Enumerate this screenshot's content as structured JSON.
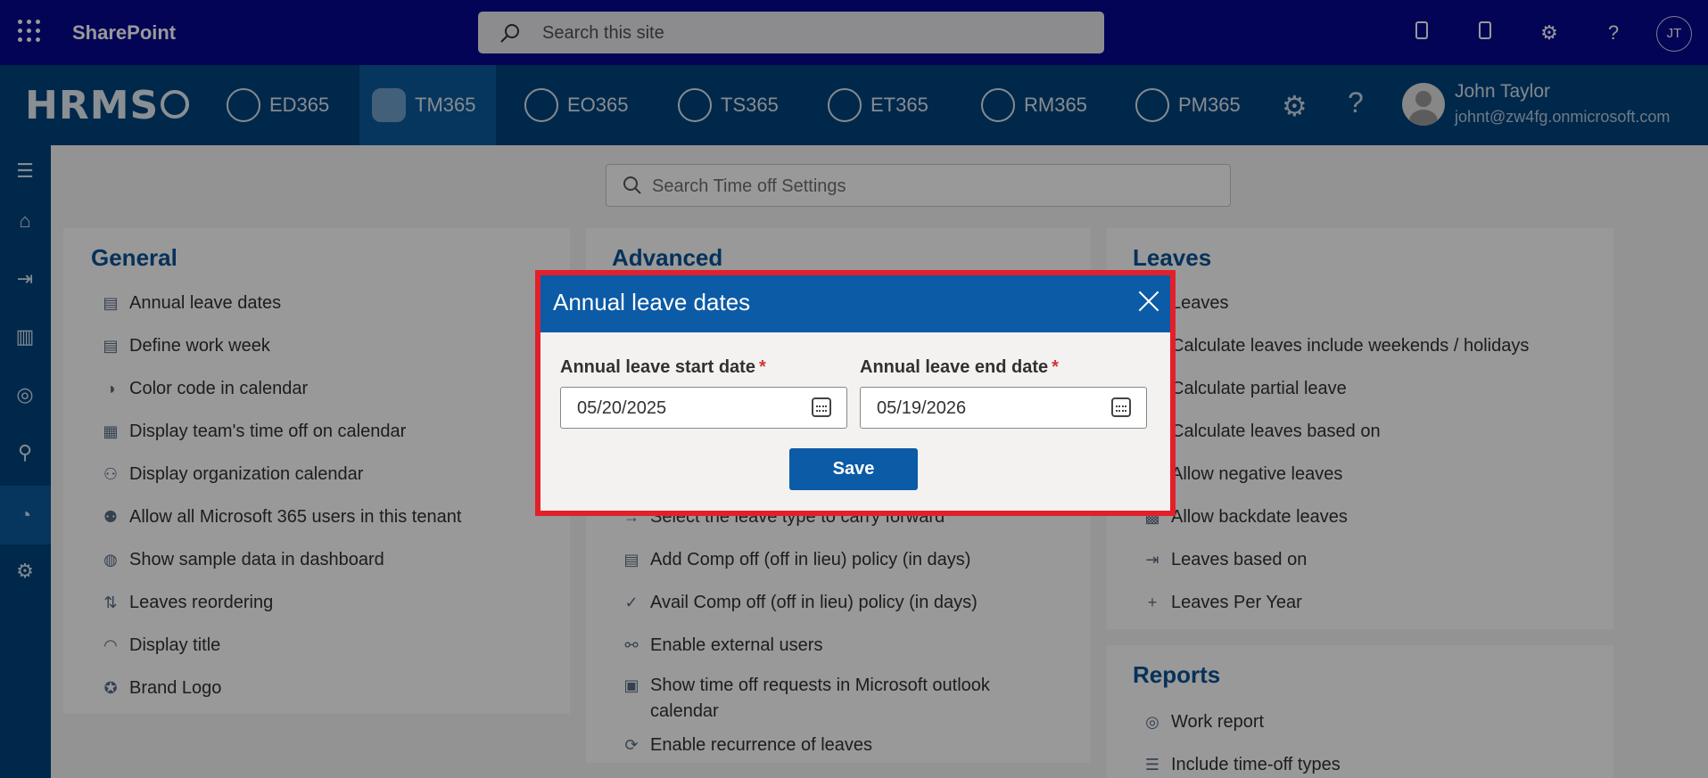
{
  "suite": {
    "app_name": "SharePoint",
    "search_placeholder": "Search this site",
    "avatar_initials": "JT"
  },
  "appbar": {
    "logo_text": "HRMS",
    "tabs": [
      {
        "label": "ED365",
        "icon": "employee-directory-icon"
      },
      {
        "label": "TM365",
        "icon": "time-off-icon",
        "active": true
      },
      {
        "label": "EO365",
        "icon": "onboarding-icon"
      },
      {
        "label": "TS365",
        "icon": "timesheet-icon"
      },
      {
        "label": "ET365",
        "icon": "expense-icon"
      },
      {
        "label": "RM365",
        "icon": "recruitment-icon"
      },
      {
        "label": "PM365",
        "icon": "performance-icon"
      }
    ],
    "user": {
      "name": "John Taylor",
      "email": "johnt@zw4fg.onmicrosoft.com"
    }
  },
  "main": {
    "search_placeholder": "Search Time off Settings",
    "general": {
      "title": "General",
      "items": [
        "Annual leave dates",
        "Define work week",
        "Color code in calendar",
        "Display team's time off on calendar",
        "Display organization calendar",
        "Allow all Microsoft 365 users in this tenant",
        "Show sample data in dashboard",
        "Leaves reordering",
        "Display title",
        "Brand Logo"
      ]
    },
    "advanced": {
      "title": "Advanced",
      "items": [
        "Select the leave type to carry forward",
        "Add Comp off (off in lieu) policy (in days)",
        "Avail Comp off (off in lieu) policy (in days)",
        "Enable external users",
        "Show time off requests in Microsoft outlook",
        "calendar",
        "Enable recurrence of leaves"
      ]
    },
    "leaves": {
      "title": "Leaves",
      "items": [
        "Leaves",
        "Calculate leaves include weekends / holidays",
        "Calculate partial leave",
        "Calculate leaves based on",
        "Allow negative leaves",
        "Allow backdate leaves",
        "Leaves based on",
        "Leaves Per Year"
      ]
    },
    "reports": {
      "title": "Reports",
      "items": [
        "Work report",
        "Include time-off types"
      ]
    }
  },
  "modal": {
    "title": "Annual leave dates",
    "start_label": "Annual leave start date",
    "end_label": "Annual leave end date",
    "required_mark": "*",
    "start_value": "05/20/2025",
    "end_value": "05/19/2026",
    "save_label": "Save"
  },
  "colors": {
    "suite_bar": "#07078f",
    "app_bar": "#00437e",
    "accent": "#0b5ba6",
    "highlight_border": "#e3202a"
  }
}
